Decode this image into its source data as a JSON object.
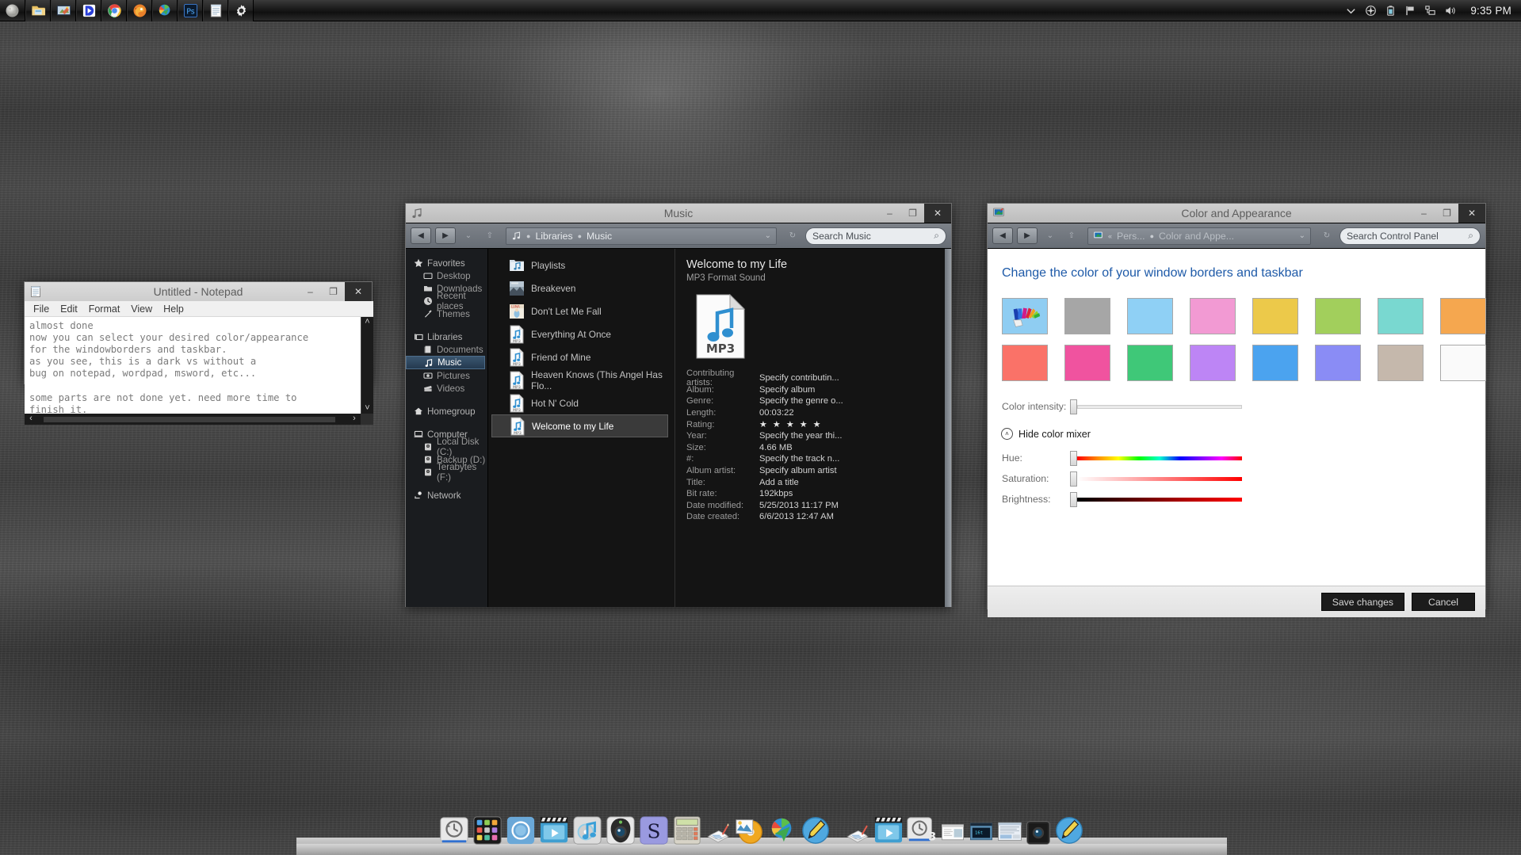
{
  "taskbar": {
    "launchers": [
      {
        "name": "moon-icon",
        "label": "Moon"
      },
      {
        "name": "file-explorer-icon",
        "label": "File Explorer"
      },
      {
        "name": "painttool-icon",
        "label": "Paint Tool"
      },
      {
        "name": "media-player-icon",
        "label": "Media Player"
      },
      {
        "name": "chrome-icon",
        "label": "Google Chrome"
      },
      {
        "name": "firefox-icon",
        "label": "Firefox"
      },
      {
        "name": "recovery-icon",
        "label": "Recovery"
      },
      {
        "name": "photoshop-icon",
        "label": "Ps"
      },
      {
        "name": "notepad-icon",
        "label": "Notepad"
      },
      {
        "name": "settings-gear-icon",
        "label": "Settings"
      }
    ],
    "tray": [
      {
        "name": "chevron-up-icon"
      },
      {
        "name": "action-center-icon"
      },
      {
        "name": "battery-icon"
      },
      {
        "name": "flag-icon"
      },
      {
        "name": "network-icon"
      },
      {
        "name": "volume-icon"
      }
    ],
    "clock": "9:35 PM"
  },
  "notepad": {
    "title": "Untitled - Notepad",
    "menu": [
      "File",
      "Edit",
      "Format",
      "View",
      "Help"
    ],
    "controls": {
      "minimize": "–",
      "maximize": "❐",
      "close": "✕"
    },
    "text": "almost done\nnow you can select your desired color/appearance\nfor the windowborders and taskbar.\nas you see, this is a dark vs without a\nbug on notepad, wordpad, msword, etc...\n\nsome parts are not done yet. need more time to\nfinish it.",
    "scroll": {
      "up": "˄",
      "down": "˅",
      "left": "‹",
      "right": "›"
    }
  },
  "explorer": {
    "title": "Music",
    "controls": {
      "minimize": "–",
      "maximize": "❐",
      "close": "✕"
    },
    "toolbar": {
      "back": "◀",
      "forward": "▶",
      "history": "⌄",
      "up": "⇧",
      "refresh": "↻",
      "crumb_dot": "●",
      "dropdown": "⌄"
    },
    "breadcrumb": [
      "Libraries",
      "Music"
    ],
    "search": {
      "placeholder": "Search Music",
      "icon": "⌕"
    },
    "nav": [
      {
        "label": "Favorites",
        "icon": "star-icon",
        "level": "head"
      },
      {
        "label": "Desktop",
        "icon": "desktop-icon",
        "level": "child"
      },
      {
        "label": "Downloads",
        "icon": "downloads-icon",
        "level": "child"
      },
      {
        "label": "Recent places",
        "icon": "recent-places-icon",
        "level": "child"
      },
      {
        "label": "Themes",
        "icon": "themes-icon",
        "level": "child"
      },
      {
        "label": "Libraries",
        "icon": "libraries-icon",
        "level": "head"
      },
      {
        "label": "Documents",
        "icon": "documents-icon",
        "level": "child"
      },
      {
        "label": "Music",
        "icon": "music-icon",
        "level": "child",
        "selected": true
      },
      {
        "label": "Pictures",
        "icon": "pictures-icon",
        "level": "child"
      },
      {
        "label": "Videos",
        "icon": "videos-icon",
        "level": "child"
      },
      {
        "label": "Homegroup",
        "icon": "homegroup-icon",
        "level": "head"
      },
      {
        "label": "Computer",
        "icon": "computer-icon",
        "level": "head"
      },
      {
        "label": "Local Disk (C:)",
        "icon": "disk-icon",
        "level": "child"
      },
      {
        "label": "Backup (D:)",
        "icon": "disk-icon",
        "level": "child"
      },
      {
        "label": "Terabytes (F:)",
        "icon": "disk-icon",
        "level": "child"
      },
      {
        "label": "Network",
        "icon": "network-icon",
        "level": "head"
      }
    ],
    "files": [
      {
        "name": "Playlists",
        "type": "folder"
      },
      {
        "name": "Breakeven",
        "type": "albumart1"
      },
      {
        "name": "Don't Let Me Fall",
        "type": "albumart2"
      },
      {
        "name": "Everything At Once",
        "type": "mp3"
      },
      {
        "name": "Friend of Mine",
        "type": "mp3"
      },
      {
        "name": "Heaven Knows (This Angel Has Flo...",
        "type": "mp3"
      },
      {
        "name": "Hot N' Cold",
        "type": "mp3"
      },
      {
        "name": "Welcome to my Life",
        "type": "mp3",
        "selected": true
      }
    ],
    "details": {
      "title": "Welcome to my Life",
      "subtitle": "MP3 Format Sound",
      "icon_label": "MP3",
      "rows": [
        {
          "key": "Contributing artists:",
          "value": "Specify contributin..."
        },
        {
          "key": "Album:",
          "value": "Specify album"
        },
        {
          "key": "Genre:",
          "value": "Specify the genre o..."
        },
        {
          "key": "Length:",
          "value": "00:03:22"
        },
        {
          "key": "Rating:",
          "value": "★ ★ ★ ★ ★",
          "is_rating": true
        },
        {
          "key": "Year:",
          "value": "Specify the year thi..."
        },
        {
          "key": "Size:",
          "value": "4.66 MB"
        },
        {
          "key": "#:",
          "value": "Specify the track n..."
        },
        {
          "key": "Album artist:",
          "value": "Specify album artist"
        },
        {
          "key": "Title:",
          "value": "Add a title"
        },
        {
          "key": "Bit rate:",
          "value": "192kbps"
        },
        {
          "key": "Date modified:",
          "value": "5/25/2013 11:17 PM"
        },
        {
          "key": "Date created:",
          "value": "6/6/2013 12:47 AM"
        }
      ]
    }
  },
  "colorwin": {
    "title": "Color and Appearance",
    "controls": {
      "minimize": "–",
      "maximize": "❐",
      "close": "✕"
    },
    "toolbar": {
      "back": "◀",
      "forward": "▶",
      "history": "⌄",
      "up": "⇧",
      "overflow": "«",
      "crumb_dot": "●",
      "refresh": "↻",
      "dropdown": "⌄"
    },
    "breadcrumb": [
      "Pers...",
      "Color and Appe..."
    ],
    "search": {
      "placeholder": "Search Control Panel",
      "icon": "⌕"
    },
    "heading": "Change the color of your window borders and taskbar",
    "swatches": [
      {
        "name": "automatic",
        "color": "#8fcdf2",
        "is_picker": true
      },
      {
        "name": "graphite",
        "color": "#a6a6a6"
      },
      {
        "name": "sky",
        "color": "#8fd0f5"
      },
      {
        "name": "pink",
        "color": "#f29ad3"
      },
      {
        "name": "gold",
        "color": "#ecc94a"
      },
      {
        "name": "lime",
        "color": "#a2cf5c"
      },
      {
        "name": "turquoise",
        "color": "#79d8d0"
      },
      {
        "name": "orange",
        "color": "#f5a74f"
      },
      {
        "name": "salmon",
        "color": "#fa7268"
      },
      {
        "name": "magenta",
        "color": "#f0539f"
      },
      {
        "name": "green",
        "color": "#3fc878"
      },
      {
        "name": "lavender",
        "color": "#bd85f5"
      },
      {
        "name": "blue",
        "color": "#4ba3ef"
      },
      {
        "name": "violet",
        "color": "#8a8cf5"
      },
      {
        "name": "taupe",
        "color": "#c5b8ac"
      },
      {
        "name": "white",
        "color": "#fafafa"
      }
    ],
    "intensity_label": "Color intensity:",
    "mixer_toggle": "Hide color mixer",
    "mixer_chevron": "˄",
    "sliders": [
      {
        "label": "Hue:",
        "track": "hue"
      },
      {
        "label": "Saturation:",
        "track": "sat"
      },
      {
        "label": "Brightness:",
        "track": "bri"
      }
    ],
    "save_label": "Save changes",
    "cancel_label": "Cancel"
  },
  "dock": {
    "items": [
      {
        "name": "time-machine-icon"
      },
      {
        "name": "launchpad-icon"
      },
      {
        "name": "chromium-icon"
      },
      {
        "name": "quicktime-icon"
      },
      {
        "name": "itunes-icon"
      },
      {
        "name": "photobooth-icon"
      },
      {
        "name": "sublime-icon"
      },
      {
        "name": "calculator-icon"
      },
      {
        "name": "notes-icon"
      },
      {
        "name": "dvd-icon"
      },
      {
        "name": "internet-download-manager-icon"
      },
      {
        "name": "pencil-icon"
      },
      {
        "name": "separator"
      },
      {
        "name": "notes2-icon"
      },
      {
        "name": "quicktime2-icon"
      },
      {
        "name": "time-machine2-icon"
      },
      {
        "name": "window-thumb1-icon"
      },
      {
        "name": "window-thumb2-icon"
      },
      {
        "name": "window-thumb3-icon"
      },
      {
        "name": "photobooth2-icon"
      },
      {
        "name": "pencil2-icon"
      }
    ]
  }
}
